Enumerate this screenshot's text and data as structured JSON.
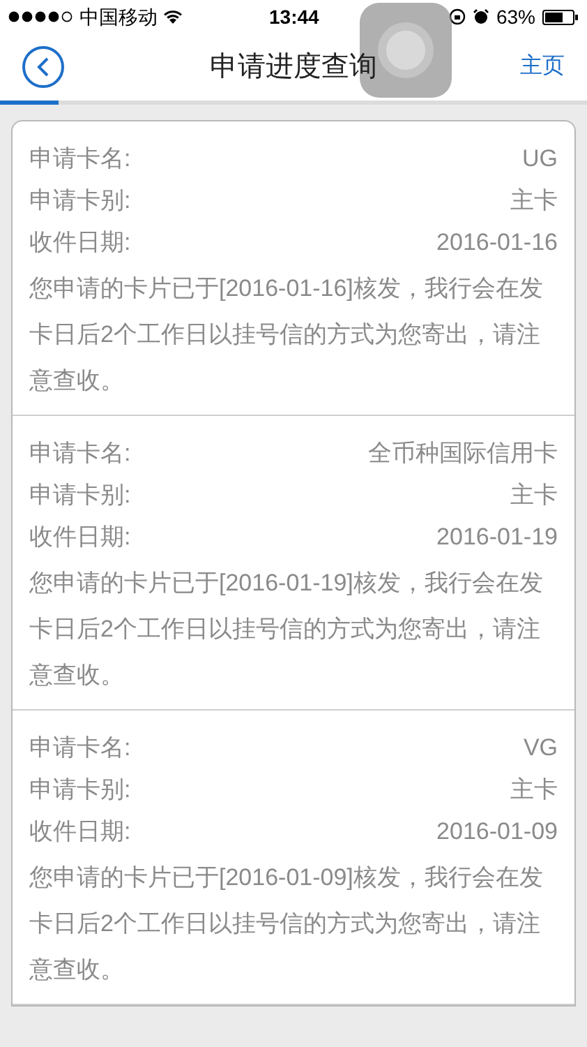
{
  "status_bar": {
    "carrier": "中国移动",
    "time": "13:44",
    "battery": "63%"
  },
  "header": {
    "title": "申请进度查询",
    "right_link": "主页"
  },
  "progress": {
    "level": 0.1
  },
  "applications": [
    {
      "fields": [
        {
          "label": "申请卡名:",
          "value": "UG"
        },
        {
          "label": "申请卡别:",
          "value": "主卡"
        },
        {
          "label": "收件日期:",
          "value": "2016-01-16"
        }
      ],
      "message": "您申请的卡片已于[2016-01-16]核发，我行会在发卡日后2个工作日以挂号信的方式为您寄出，请注意查收。"
    },
    {
      "fields": [
        {
          "label": "申请卡名:",
          "value": "全币种国际信用卡"
        },
        {
          "label": "申请卡别:",
          "value": "主卡"
        },
        {
          "label": "收件日期:",
          "value": "2016-01-19"
        }
      ],
      "message": "您申请的卡片已于[2016-01-19]核发，我行会在发卡日后2个工作日以挂号信的方式为您寄出，请注意查收。"
    },
    {
      "fields": [
        {
          "label": "申请卡名:",
          "value": "VG"
        },
        {
          "label": "申请卡别:",
          "value": "主卡"
        },
        {
          "label": "收件日期:",
          "value": "2016-01-09"
        }
      ],
      "message": "您申请的卡片已于[2016-01-09]核发，我行会在发卡日后2个工作日以挂号信的方式为您寄出，请注意查收。"
    }
  ]
}
